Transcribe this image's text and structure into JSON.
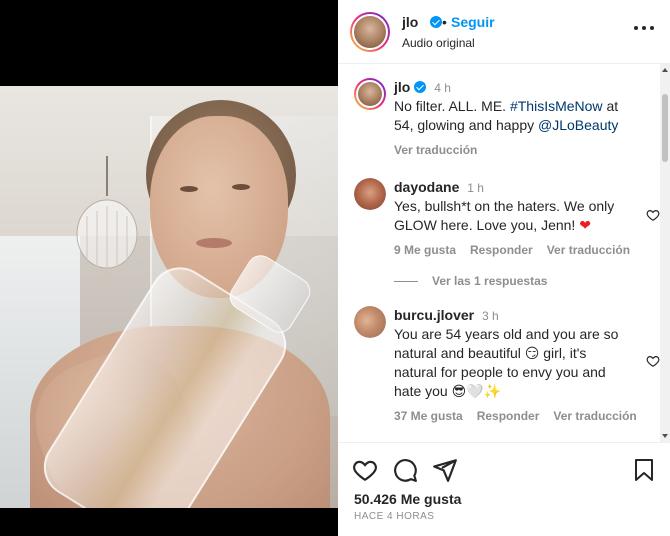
{
  "post": {
    "author": "jlo",
    "separator": "•",
    "follow_label": "Seguir",
    "audio_label": "Audio original",
    "likes": "50.426 Me gusta",
    "timestamp": "HACE 4 HORAS"
  },
  "caption": {
    "username": "jlo",
    "time": "4 h",
    "text_part1": "No filter. ALL. ME.",
    "hashtag": "#ThisIsMeNow",
    "text_part2": "at 54, glowing and happy",
    "mention": "@JLoBeauty",
    "translate": "Ver traducción"
  },
  "comments": [
    {
      "username": "dayodane",
      "time": "1 h",
      "text": "Yes, bullsh*t on the haters. We only GLOW here. Love you, Jenn!",
      "emoji": "❤",
      "likes": "9 Me gusta",
      "reply": "Responder",
      "translate": "Ver traducción",
      "replies_label": "Ver las 1 respuestas"
    },
    {
      "username": "burcu.jlover",
      "time": "3 h",
      "text": "You are 54 years old and you are so natural and beautiful",
      "emoji1": "😏",
      "text2": "girl, it's natural for people to envy you and hate you",
      "emoji2": "😎🤍✨",
      "likes": "37 Me gusta",
      "reply": "Responder",
      "translate": "Ver traducción"
    }
  ],
  "colors": {
    "accent": "#0095f6",
    "verified": "#0095f6",
    "heart": "#ed1c24",
    "muted": "#8e8e8e"
  },
  "icons": [
    "more-options-icon",
    "verified-icon",
    "heart-icon",
    "comment-icon",
    "share-icon",
    "bookmark-icon"
  ]
}
